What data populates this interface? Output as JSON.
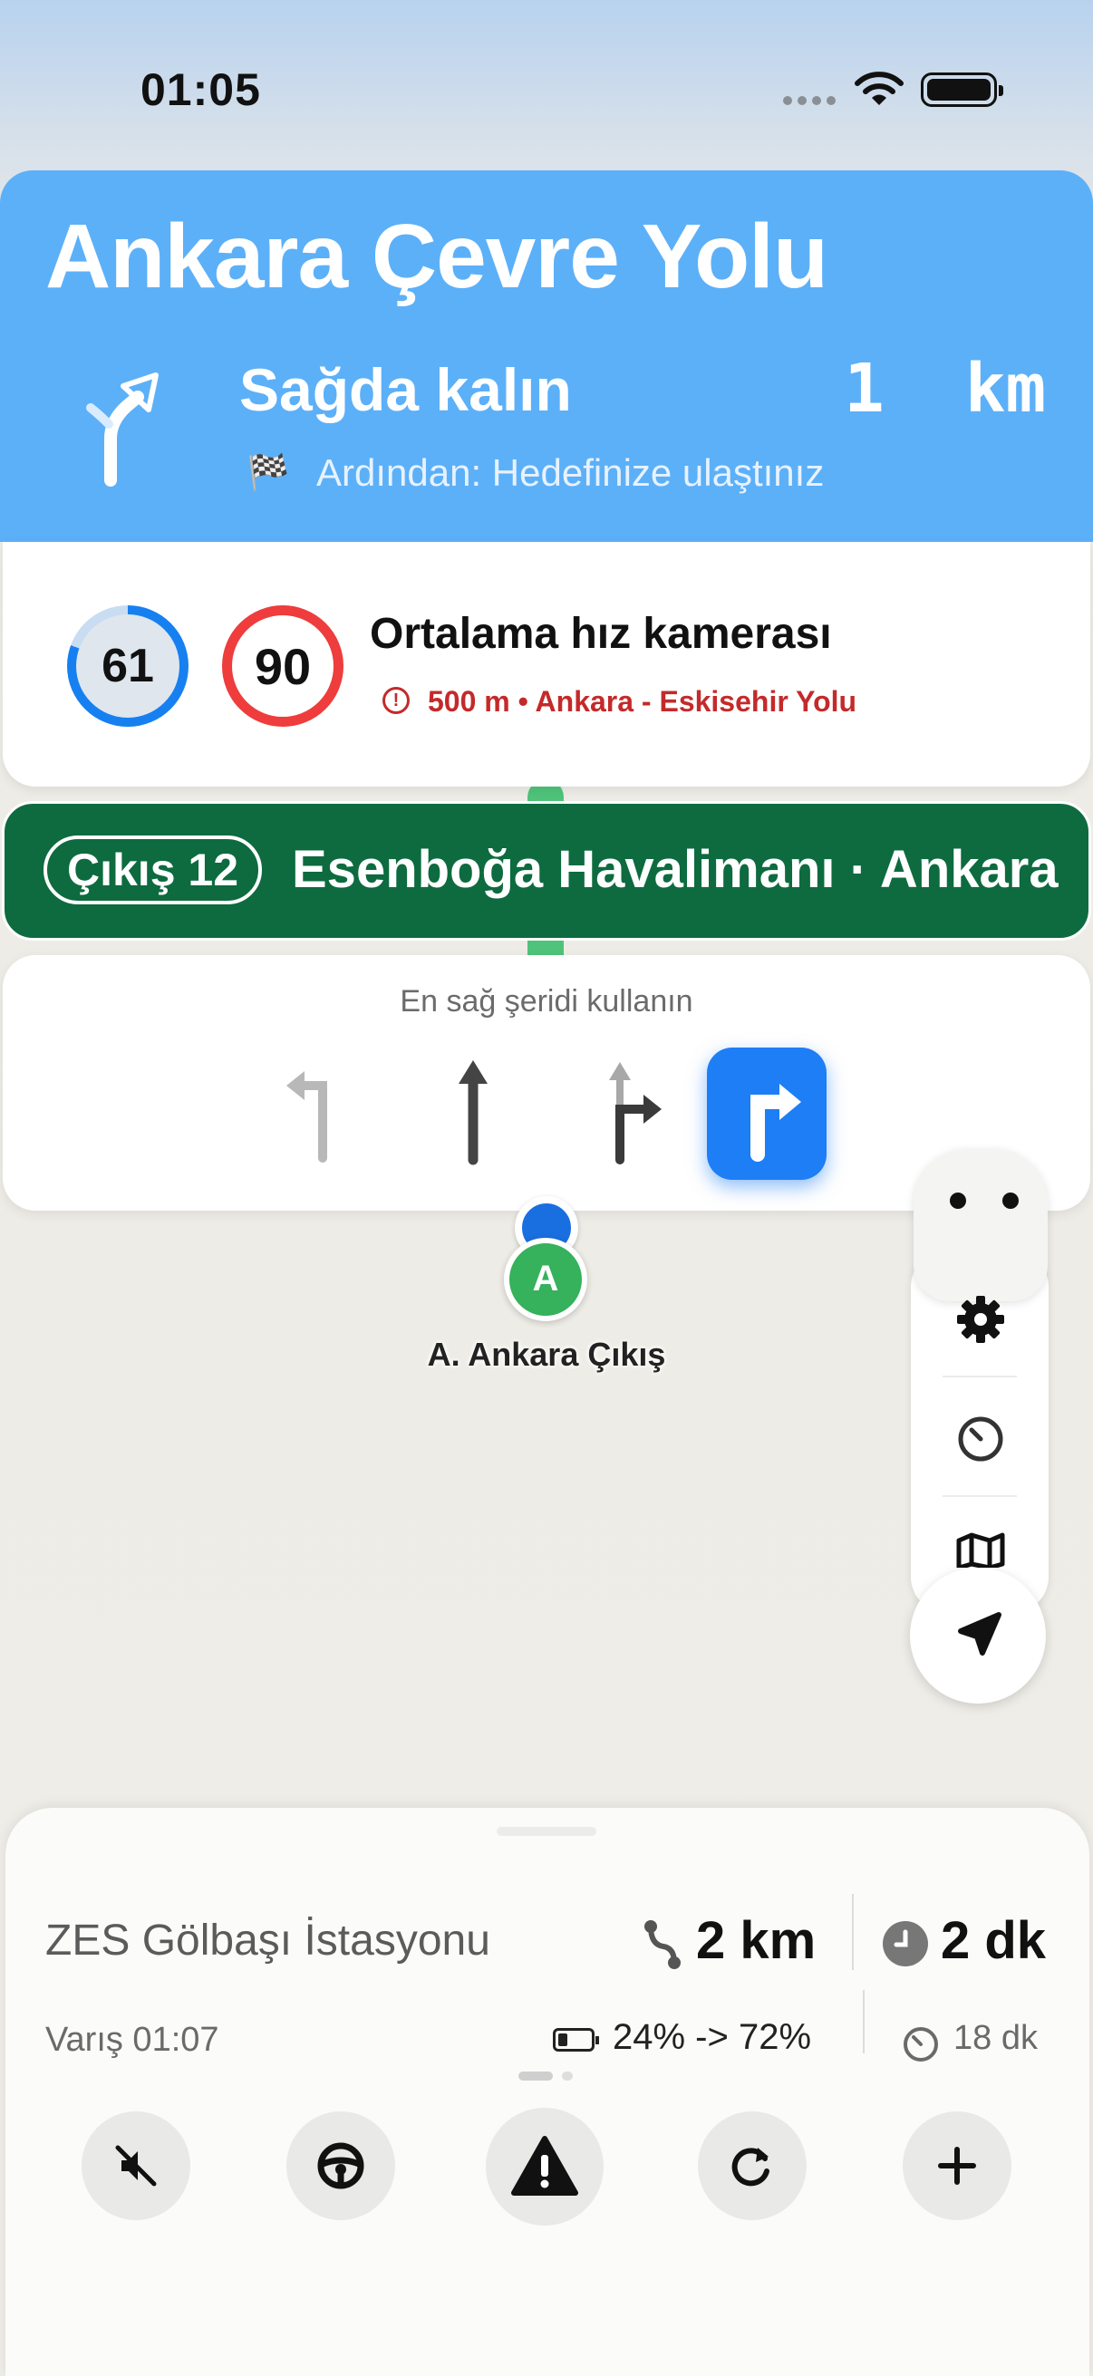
{
  "status_bar": {
    "time": "01:05"
  },
  "banner": {
    "road_name": "Ankara Çevre Yolu",
    "instruction": "Sağda kalın",
    "distance": "1  km",
    "then_text": "Ardından: Hedefinize ulaştınız",
    "color": "#5cb0f8"
  },
  "camera": {
    "current_speed": "61",
    "speed_limit": "90",
    "title": "Ortalama hız kamerası",
    "detail": "500 m • Ankara - Eskisehir Yolu",
    "alert_color": "#c42a2a"
  },
  "exit": {
    "badge": "Çıkış 12",
    "destination": "Esenboğa Havalimanı · Ankara",
    "color": "#0d6b3f"
  },
  "lanes": {
    "title": "En sağ şeridi kullanın",
    "items": [
      "left",
      "straight",
      "straight-right",
      "right (active)"
    ]
  },
  "map": {
    "pin_letter": "A",
    "pin_label": "A. Ankara Çıkış"
  },
  "controls": [
    "settings-icon",
    "speedometer-icon",
    "map-icon",
    "locate-arrow-icon"
  ],
  "trip": {
    "destination": "ZES Gölbaşı İstasyonu",
    "distance": "2 km",
    "duration": "2 dk",
    "arrival": "Varış 01:07",
    "charge": "24% -> 72%",
    "charge_time": "18 dk"
  },
  "actions": [
    "mute-icon",
    "steering-wheel-icon",
    "hazard-report-icon",
    "reroute-icon",
    "add-icon"
  ]
}
